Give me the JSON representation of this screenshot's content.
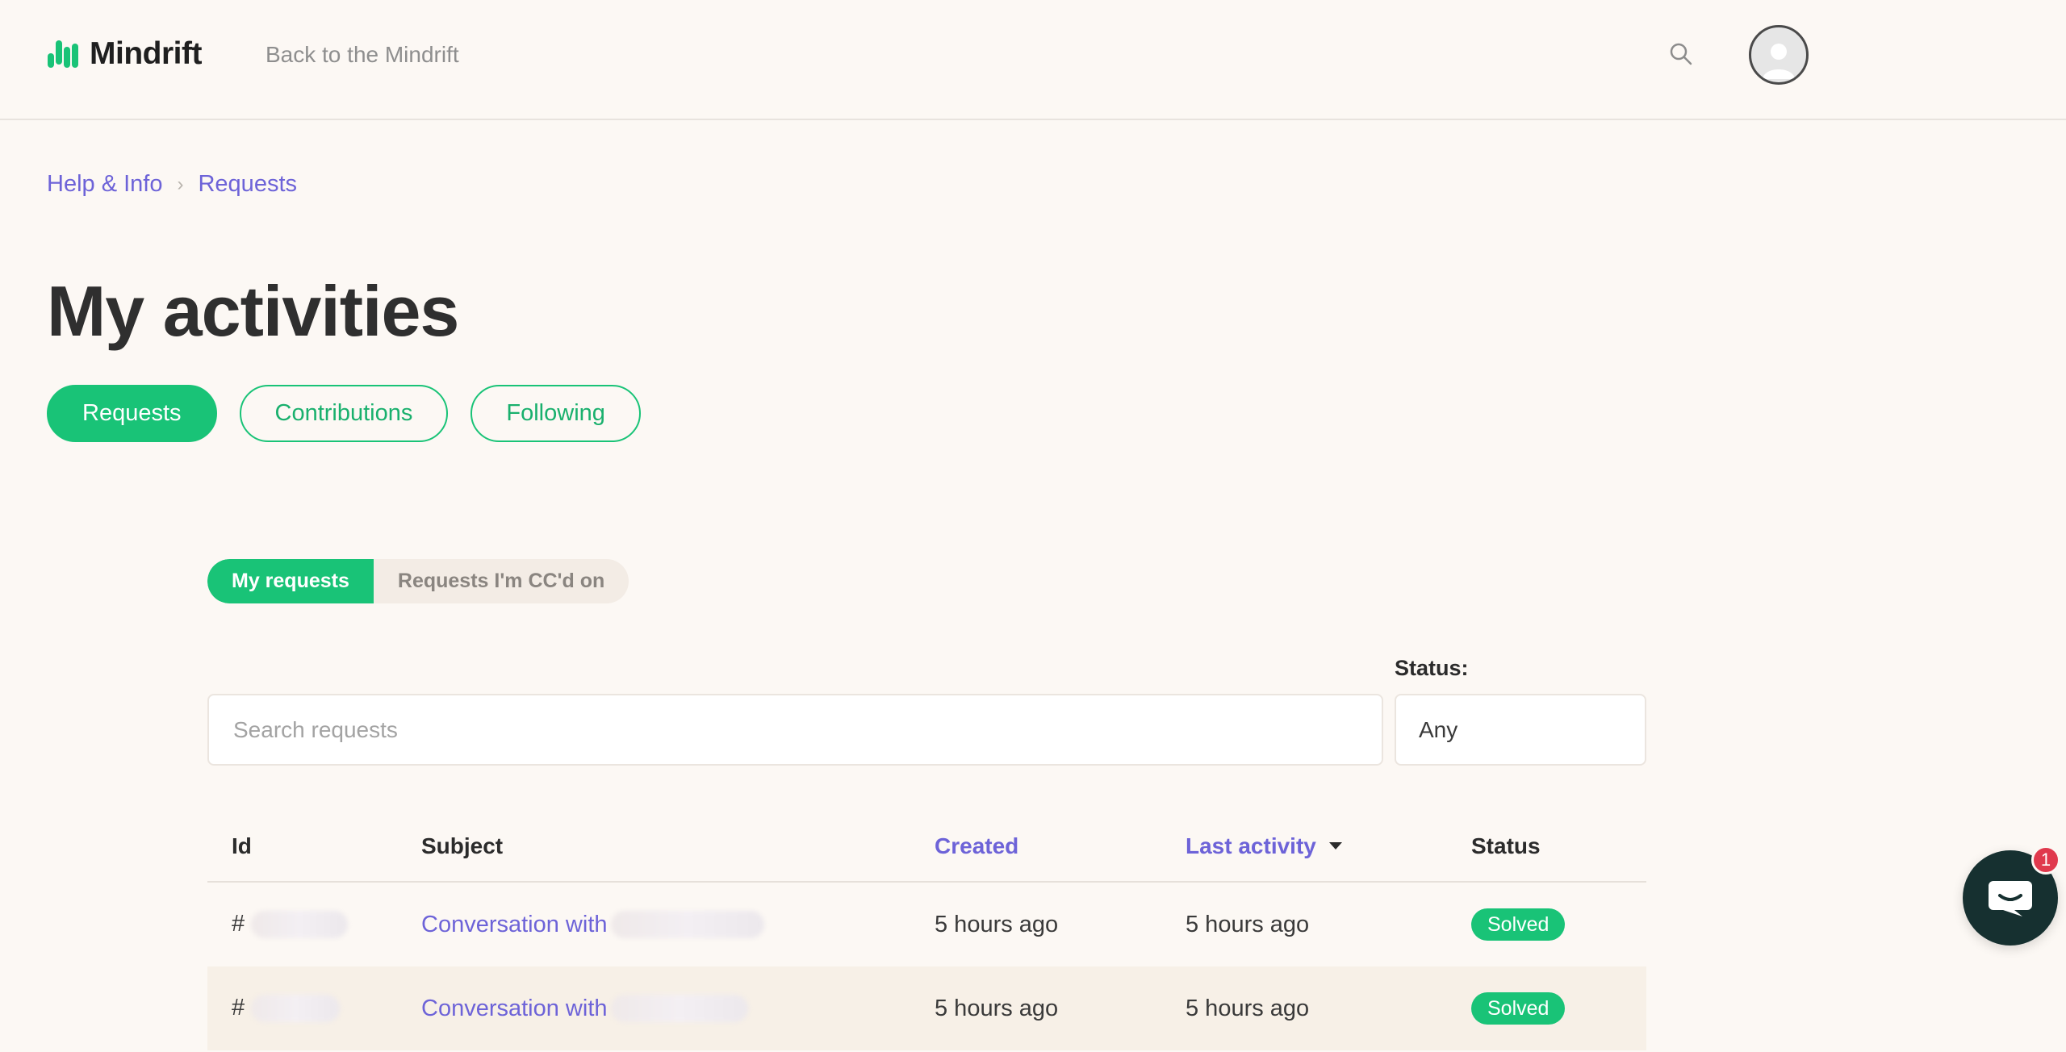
{
  "header": {
    "logo_text": "Mindrift",
    "back_link": "Back to the Mindrift",
    "search_icon": "search-icon",
    "avatar_icon": "user-avatar-icon"
  },
  "breadcrumb": {
    "items": [
      "Help & Info",
      "Requests"
    ],
    "separator_icon": "chevron-right-icon"
  },
  "page": {
    "title": "My activities",
    "tabs": [
      {
        "label": "Requests",
        "active": true
      },
      {
        "label": "Contributions",
        "active": false
      },
      {
        "label": "Following",
        "active": false
      }
    ]
  },
  "sub_tabs": [
    {
      "label": "My requests",
      "active": true
    },
    {
      "label": "Requests I'm CC'd on",
      "active": false
    }
  ],
  "filters": {
    "search_placeholder": "Search requests",
    "status_label": "Status:",
    "status_value": "Any"
  },
  "table": {
    "headers": {
      "id": "Id",
      "subject": "Subject",
      "created": "Created",
      "last_activity": "Last activity",
      "status": "Status"
    },
    "sort_icon": "caret-down-icon",
    "rows": [
      {
        "id": "#",
        "subject": "Conversation with",
        "created": "5 hours ago",
        "last_activity": "5 hours ago",
        "status": "Solved"
      },
      {
        "id": "#",
        "subject": "Conversation with",
        "created": "5 hours ago",
        "last_activity": "5 hours ago",
        "status": "Solved"
      }
    ]
  },
  "chat": {
    "icon": "chat-bubble-icon",
    "badge_count": "1"
  },
  "colors": {
    "accent_green": "#19c377",
    "link_purple": "#6d63d8",
    "background": "#fcf8f4",
    "chat_dark": "#163030",
    "badge_red": "#e0394d"
  }
}
